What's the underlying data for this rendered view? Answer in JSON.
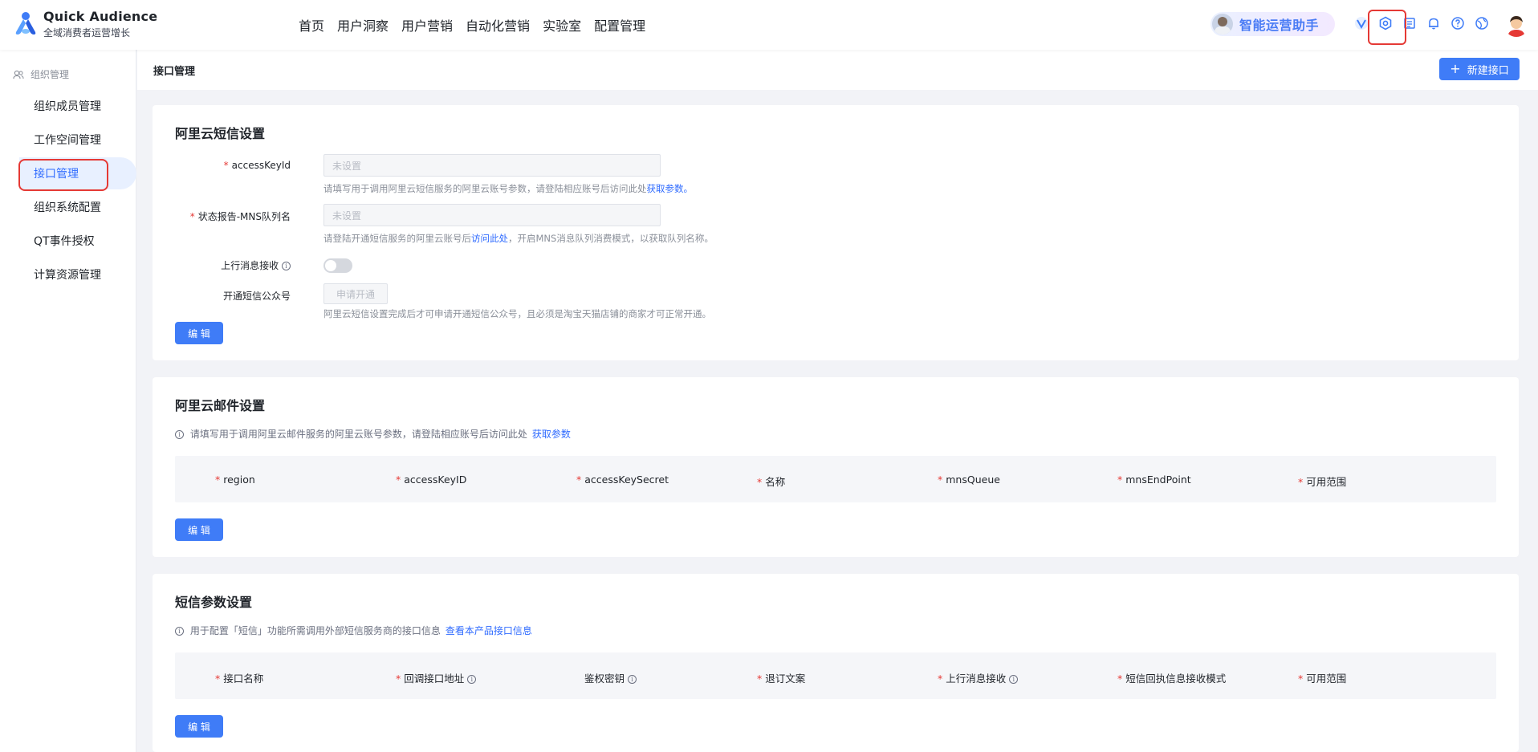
{
  "brand": {
    "name": "Quick Audience",
    "subtitle": "全域消费者运营增长"
  },
  "nav": {
    "items": [
      "首页",
      "用户洞察",
      "用户营销",
      "自动化营销",
      "实验室",
      "配置管理"
    ]
  },
  "assistant": {
    "label": "智能运营助手"
  },
  "header_icons": [
    "v-icon",
    "settings-gear-icon",
    "document-list-icon",
    "bell-icon",
    "help-circle-icon",
    "globe-icon"
  ],
  "colors": {
    "primary": "#3f7cf7",
    "highlight": "#e53935",
    "required": "#e53935"
  },
  "sidebar": {
    "group": "组织管理",
    "items": [
      {
        "label": "组织成员管理",
        "active": false
      },
      {
        "label": "工作空间管理",
        "active": false
      },
      {
        "label": "接口管理",
        "active": true
      },
      {
        "label": "组织系统配置",
        "active": false
      },
      {
        "label": "QT事件授权",
        "active": false
      },
      {
        "label": "计算资源管理",
        "active": false
      }
    ]
  },
  "page": {
    "title": "接口管理",
    "new_button": "新建接口"
  },
  "sms": {
    "title": "阿里云短信设置",
    "access_key_label": "accessKeyId",
    "access_key_placeholder": "未设置",
    "access_key_hint": "请填写用于调用阿里云短信服务的阿里云账号参数，请登陆相应账号后访问此处",
    "access_key_link": "获取参数。",
    "mns_label": "状态报告-MNS队列名",
    "mns_placeholder": "未设置",
    "mns_hint_pre": "请登陆开通短信服务的阿里云账号后",
    "mns_link": "访问此处",
    "mns_hint_post": "，开启MNS消息队列消费模式，以获取队列名称。",
    "uplink_label": "上行消息接收",
    "uplink_enabled": false,
    "official_label": "开通短信公众号",
    "official_button": "申请开通",
    "official_hint": "阿里云短信设置完成后才可申请开通短信公众号，且必须是淘宝天猫店铺的商家才可正常开通。",
    "edit_button": "编 辑"
  },
  "mail": {
    "title": "阿里云邮件设置",
    "desc": "请填写用于调用阿里云邮件服务的阿里云账号参数，请登陆相应账号后访问此处",
    "desc_link": "获取参数",
    "columns": [
      "region",
      "accessKeyID",
      "accessKeySecret",
      "名称",
      "mnsQueue",
      "mnsEndPoint",
      "可用范围"
    ],
    "edit_button": "编 辑"
  },
  "smsparam": {
    "title": "短信参数设置",
    "desc": "用于配置「短信」功能所需调用外部短信服务商的接口信息",
    "desc_link": "查看本产品接口信息",
    "columns": [
      {
        "label": "接口名称",
        "required": true,
        "info": false
      },
      {
        "label": "回调接口地址",
        "required": true,
        "info": true
      },
      {
        "label": "鉴权密钥",
        "required": false,
        "info": true
      },
      {
        "label": "退订文案",
        "required": true,
        "info": false
      },
      {
        "label": "上行消息接收",
        "required": true,
        "info": true
      },
      {
        "label": "短信回执信息接收模式",
        "required": true,
        "info": false
      },
      {
        "label": "可用范围",
        "required": true,
        "info": false
      }
    ],
    "edit_button": "编 辑"
  }
}
